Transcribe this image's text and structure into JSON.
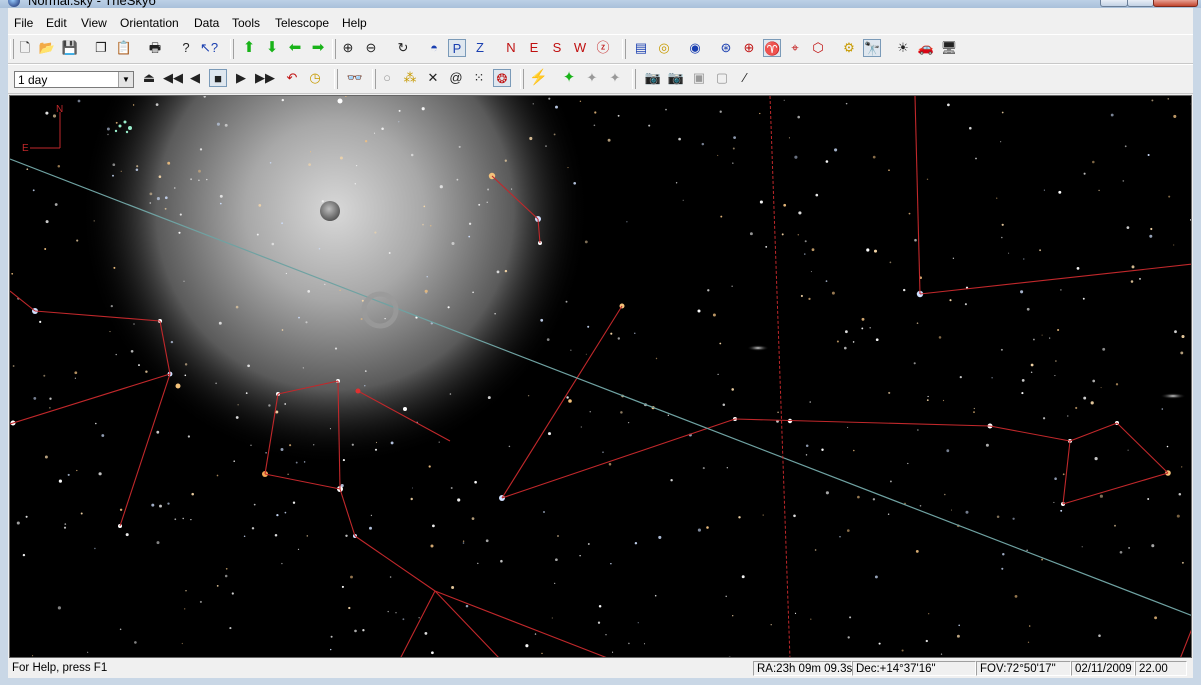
{
  "window": {
    "title": "Normal.sky - TheSkyб"
  },
  "menu": [
    "File",
    "Edit",
    "View",
    "Orientation",
    "Data",
    "Tools",
    "Telescope",
    "Help"
  ],
  "toolbar1": {
    "file": [
      "new-file-icon",
      "open-folder-icon",
      "save-icon"
    ],
    "edit": [
      "copy-icon",
      "paste-icon"
    ],
    "print": [
      "print-icon"
    ],
    "help": [
      "help-icon",
      "context-help-icon"
    ],
    "nav": [
      "move-up-icon",
      "move-down-icon",
      "move-left-icon",
      "move-right-icon"
    ],
    "zoom": [
      "zoom-in-icon",
      "zoom-out-icon",
      "rotate-icon"
    ],
    "horizon": [
      "horizon-icon",
      "pole-icon",
      "zenith-icon"
    ],
    "orientation": [
      "north-icon",
      "east-icon",
      "south-icon",
      "west-icon",
      "zenith-circle-icon"
    ],
    "tools": [
      "object-info-icon",
      "ellipse-icon",
      "earth-view-icon",
      "globe-icon",
      "grid-icon",
      "constellation-icon",
      "crosshair-icon",
      "boundary-icon"
    ],
    "misc": [
      "telescope-link-icon",
      "telescope-find-icon",
      "sun-icon",
      "car-icon",
      "monitor-icon"
    ]
  },
  "toolbar2": {
    "time_step": "1 day",
    "time_controls": [
      "eject-icon",
      "fast-rewind-icon",
      "step-back-icon",
      "stop-icon",
      "step-forward-icon",
      "fast-forward-icon",
      "undo-arc-icon",
      "clock-icon"
    ],
    "find": [
      "binoculars-icon"
    ],
    "filters": [
      "filter-circle-icon",
      "filter-stars-icon",
      "filter-cross-icon",
      "filter-galaxy-icon",
      "filter-cluster-icon",
      "filter-owl-icon"
    ],
    "scope": [
      "telescope-slew-icon",
      "telescope-connect-icon",
      "telescope-disconnect-icon",
      "telescope-park-icon"
    ],
    "camera": [
      "camera-icon",
      "camera-disabled-icon",
      "image-icon",
      "image-frame-icon",
      "wand-icon"
    ]
  },
  "sky": {
    "compass": {
      "north": "N",
      "east": "E"
    }
  },
  "status": {
    "help": "For Help, press F1",
    "ra": "RA:23h 09m 09.3s",
    "dec": "Dec:+14°37'16\"",
    "fov": "FOV:72°50'17\"",
    "date": "02/11/2009",
    "time": "22.00"
  },
  "colors": {
    "constellation": "#c1282b",
    "ecliptic": "#6fa2a2",
    "sky": "#000000"
  }
}
